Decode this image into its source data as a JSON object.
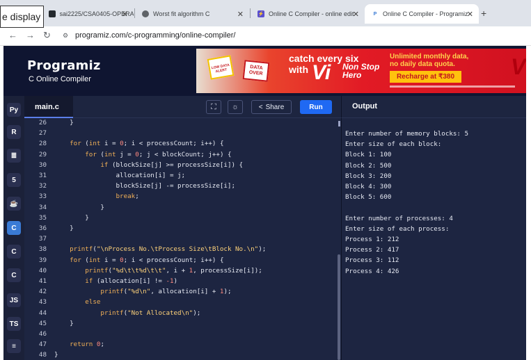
{
  "browser": {
    "tooltip": "e display",
    "tabs": [
      {
        "title": "sai2225/CSA0405-OPERAT",
        "active": false
      },
      {
        "title": "Worst fit algorithm C",
        "active": false
      },
      {
        "title": "Online C Compiler - online edit",
        "active": false
      },
      {
        "title": "Online C Compiler - Programiz",
        "active": true
      }
    ],
    "new_tab": "+",
    "close_glyph": "✕",
    "nav": {
      "back": "←",
      "forward": "→",
      "reload": "↻"
    },
    "url": "programiz.com/c-programming/online-compiler/"
  },
  "header": {
    "logo": "Programiz",
    "subtitle": "C Online Compiler",
    "ad": {
      "sign1": "LOW DATA ALERT",
      "sign2": "DATA OVER",
      "line1": "catch every six",
      "line2": "with",
      "brand": "Vi",
      "tagline": "Non Stop Hero",
      "offer": "Unlimited monthly data, no daily data quota.",
      "cta": "Recharge at ₹380",
      "logo_mark": "V"
    }
  },
  "sidebar": {
    "icons": [
      {
        "name": "python-icon",
        "glyph": "Py",
        "active": false
      },
      {
        "name": "r-icon",
        "glyph": "R",
        "active": false
      },
      {
        "name": "sql-icon",
        "glyph": "≣",
        "active": false
      },
      {
        "name": "html-icon",
        "glyph": "5",
        "active": false
      },
      {
        "name": "java-icon",
        "glyph": "☕",
        "active": false
      },
      {
        "name": "c-icon",
        "glyph": "C",
        "active": true
      },
      {
        "name": "cpp-icon",
        "glyph": "C",
        "active": false
      },
      {
        "name": "csharp-icon",
        "glyph": "C",
        "active": false
      },
      {
        "name": "js-icon",
        "glyph": "JS",
        "active": false
      },
      {
        "name": "ts-icon",
        "glyph": "TS",
        "active": false
      },
      {
        "name": "menu-icon",
        "glyph": "≡",
        "active": false
      }
    ]
  },
  "editor": {
    "file_tab": "main.c",
    "fullscreen_glyph": "⛶",
    "theme_glyph": "☼",
    "share_label": "Share",
    "share_glyph": "<",
    "run_label": "Run",
    "lines": [
      {
        "n": "26",
        "code": "    }"
      },
      {
        "n": "27",
        "code": ""
      },
      {
        "n": "28",
        "code": "    for (int i = 0; i < processCount; i++) {"
      },
      {
        "n": "29",
        "code": "        for (int j = 0; j < blockCount; j++) {"
      },
      {
        "n": "30",
        "code": "            if (blockSize[j] >= processSize[i]) {"
      },
      {
        "n": "31",
        "code": "                allocation[i] = j;"
      },
      {
        "n": "32",
        "code": "                blockSize[j] -= processSize[i];"
      },
      {
        "n": "33",
        "code": "                break;"
      },
      {
        "n": "34",
        "code": "            }"
      },
      {
        "n": "35",
        "code": "        }"
      },
      {
        "n": "36",
        "code": "    }"
      },
      {
        "n": "37",
        "code": ""
      },
      {
        "n": "38",
        "code": "    printf(\"\\nProcess No.\\tProcess Size\\tBlock No.\\n\");"
      },
      {
        "n": "39",
        "code": "    for (int i = 0; i < processCount; i++) {"
      },
      {
        "n": "40",
        "code": "        printf(\"%d\\t\\t%d\\t\\t\", i + 1, processSize[i]);"
      },
      {
        "n": "41",
        "code": "        if (allocation[i] != -1)"
      },
      {
        "n": "42",
        "code": "            printf(\"%d\\n\", allocation[i] + 1);"
      },
      {
        "n": "43",
        "code": "        else"
      },
      {
        "n": "44",
        "code": "            printf(\"Not Allocated\\n\");"
      },
      {
        "n": "45",
        "code": "    }"
      },
      {
        "n": "46",
        "code": ""
      },
      {
        "n": "47",
        "code": "    return 0;"
      },
      {
        "n": "48",
        "code": "}"
      }
    ]
  },
  "output": {
    "title": "Output",
    "lines": [
      "Enter number of memory blocks: 5",
      "Enter size of each block:",
      "Block 1: 100",
      "Block 2: 500",
      "Block 3: 200",
      "Block 4: 300",
      "Block 5: 600",
      "",
      "Enter number of processes: 4",
      "Enter size of each process:",
      "Process 1: 212",
      "Process 2: 417",
      "Process 3: 112",
      "Process 4: 426"
    ]
  }
}
